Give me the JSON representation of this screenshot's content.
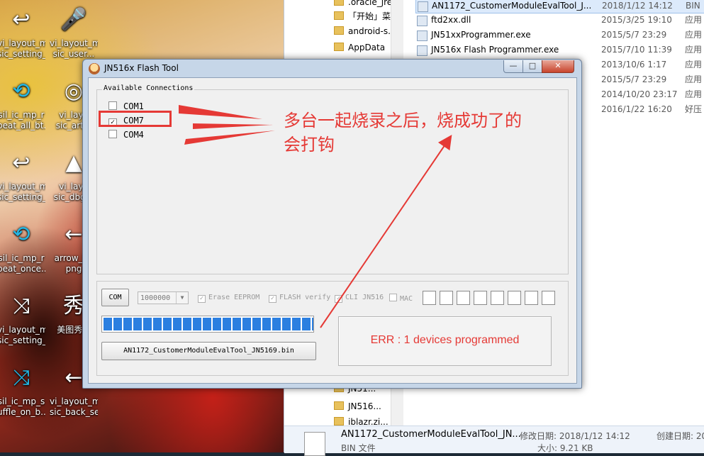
{
  "desktop": {
    "icons": [
      {
        "id": "i1",
        "glyph": "↩",
        "color": "white",
        "label": "vi_layout_mu\nsic_setting_..."
      },
      {
        "id": "i2",
        "glyph": "🎤",
        "color": "white",
        "label": "vi_layout_mu\nsic_user..."
      },
      {
        "id": "i3",
        "glyph": "⟲",
        "color": "blue",
        "label": "sil_ic_mp_r\npeat_all_bt..."
      },
      {
        "id": "i4",
        "glyph": "◎",
        "color": "white",
        "label": "vi_layo\nsic_art..."
      },
      {
        "id": "i5",
        "glyph": "↩",
        "color": "white",
        "label": "vi_layout_mu\nsic_setting_..."
      },
      {
        "id": "i6",
        "glyph": "▲",
        "color": "white",
        "label": "vi_layo\nsic_dbg..."
      },
      {
        "id": "i7",
        "glyph": "⟲",
        "color": "blue",
        "label": "sil_ic_mp_r\npeat_once..."
      },
      {
        "id": "i8",
        "glyph": "←",
        "color": "white",
        "label": "arrow_l...\npng"
      },
      {
        "id": "i9",
        "glyph": "⤨",
        "color": "white",
        "label": "vi_layout_mu\nsic_setting_..."
      },
      {
        "id": "i10",
        "glyph": "秀",
        "color": "white",
        "label": "美图秀..."
      },
      {
        "id": "i11",
        "glyph": "⤨",
        "color": "blue",
        "label": "sil_ic_mp_s\nuffle_on_b..."
      },
      {
        "id": "i12",
        "glyph": "←",
        "color": "white",
        "label": "vi_layout_mu\nsic_back_se..."
      }
    ]
  },
  "explorer": {
    "tree": [
      ".oracle_jre...",
      "「开始」菜...",
      "android-s...",
      "AppData",
      "JN51...",
      "JN516...",
      "iblazr.zi..."
    ],
    "files": [
      {
        "name": "AN1172_CustomerModuleEvalTool_J...",
        "date": "2018/1/12 14:12",
        "type": "BIN"
      },
      {
        "name": "ftd2xx.dll",
        "date": "2015/3/25 19:10",
        "type": "应用"
      },
      {
        "name": "JN51xxProgrammer.exe",
        "date": "2015/5/7 23:29",
        "type": "应用"
      },
      {
        "name": "JN516x Flash Programmer.exe",
        "date": "2015/7/10 11:39",
        "type": "应用"
      },
      {
        "name": "",
        "date": "2013/10/6 1:17",
        "type": "应用"
      },
      {
        "name": "",
        "date": "2015/5/7 23:29",
        "type": "应用"
      },
      {
        "name": "",
        "date": "2014/10/20 23:17",
        "type": "应用"
      },
      {
        "name": "",
        "date": "2016/1/22 16:20",
        "type": "好压"
      }
    ],
    "status": {
      "filename": "AN1172_CustomerModuleEvalTool_JN...",
      "modified_label": "修改日期: 2018/1/12 14:12",
      "created_label": "创建日期: 20",
      "type_label": "BIN 文件",
      "size_label": "大小: 9.21 KB"
    }
  },
  "flash_tool": {
    "title": "JN516x Flash Tool",
    "window_buttons": {
      "minimize": "—",
      "maximize": "□",
      "close": "✕"
    },
    "connections": {
      "legend": "Available Connections",
      "ports": [
        {
          "name": "COM1",
          "checked": false
        },
        {
          "name": "COM7",
          "checked": true
        },
        {
          "name": "COM4",
          "checked": false
        }
      ]
    },
    "controls": {
      "com_button": "COM",
      "baud_value": "1000000",
      "erase_label": "Erase EEPROM",
      "flash_verify_label": "FLASH verify",
      "cli_label": "CLI JN516",
      "mac_label": "MAC",
      "mac_boxes": 8,
      "file_button": "AN1172_CustomerModuleEvalTool_JN5169.bin",
      "progress_fraction": 1.0
    },
    "status_text": "ERR :  1 devices programmed"
  },
  "annotation": {
    "line1": "多台一起烧录之后，烧成功了的",
    "line2": "会打钩",
    "color": "#e53935"
  }
}
